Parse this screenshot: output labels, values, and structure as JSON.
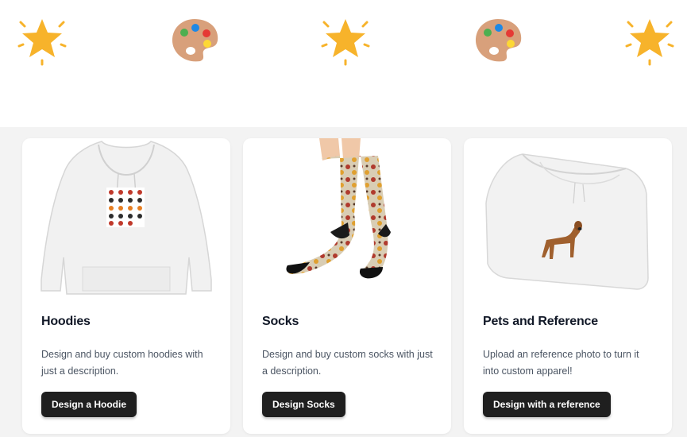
{
  "decorations": [
    {
      "icon": "sparkle-star-icon"
    },
    {
      "icon": "artist-palette-icon"
    },
    {
      "icon": "sparkle-star-icon"
    },
    {
      "icon": "artist-palette-icon"
    },
    {
      "icon": "sparkle-star-icon"
    }
  ],
  "cards": [
    {
      "image": "white-hoodie-with-sushi-print",
      "title": "Hoodies",
      "description": "Design and buy custom hoodies with just a description.",
      "button": "Design a Hoodie"
    },
    {
      "image": "patterned-socks-on-legs",
      "title": "Socks",
      "description": "Design and buy custom socks with just a description.",
      "button": "Design Socks"
    },
    {
      "image": "folded-hoodie-with-dog-print",
      "title": "Pets and Reference",
      "description": "Upload an reference photo to turn it into custom apparel!",
      "button": "Design with a reference"
    }
  ],
  "colors": {
    "star": "#f7b32b",
    "palette": "#d8a07b",
    "button": "#1f1f1f",
    "band": "#f3f3f3"
  }
}
